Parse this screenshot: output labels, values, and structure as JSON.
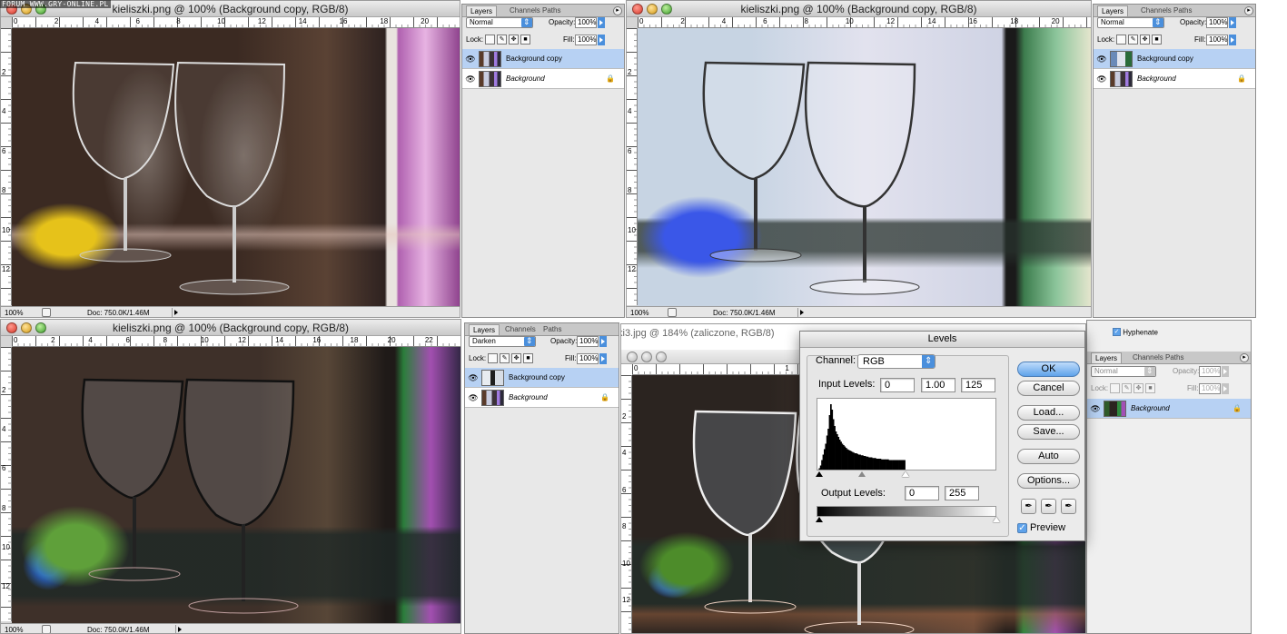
{
  "watermark": "FORUM WWW.GRY-ONLINE.PL",
  "windows": [
    {
      "title": "kieliszki.png @ 100% (Background copy, RGB/8)",
      "ruler_numbers": [
        "0",
        "2",
        "4",
        "6",
        "8",
        "10",
        "12",
        "14",
        "16",
        "18",
        "20"
      ],
      "ruler_v_numbers": [
        "2",
        "4",
        "6",
        "8",
        "10",
        "12"
      ],
      "zoom": "100%",
      "doc": "Doc: 750.0K/1.46M"
    },
    {
      "title": "kieliszki.png @ 100% (Background copy, RGB/8)",
      "ruler_numbers": [
        "0",
        "2",
        "4",
        "6",
        "8",
        "10",
        "12",
        "14",
        "16",
        "18",
        "20"
      ],
      "ruler_v_numbers": [
        "2",
        "4",
        "6",
        "8",
        "10",
        "12"
      ],
      "zoom": "100%",
      "doc": "Doc: 750.0K/1.46M"
    },
    {
      "title": "kieliszki.png @ 100% (Background copy, RGB/8)",
      "ruler_numbers": [
        "0",
        "2",
        "4",
        "6",
        "8",
        "10",
        "12",
        "14",
        "16",
        "18",
        "20",
        "22"
      ],
      "ruler_v_numbers": [
        "2",
        "4",
        "6",
        "8",
        "10",
        "12"
      ],
      "zoom": "100%",
      "doc": "Doc: 750.0K/1.46M"
    },
    {
      "title": "ki3.jpg @ 184% (zaliczone, RGB/8)",
      "ruler_numbers": [
        "0",
        "1",
        "2"
      ],
      "ruler_v_numbers": [
        "2",
        "4",
        "6",
        "8",
        "10",
        "12"
      ]
    }
  ],
  "palettes": [
    {
      "tabs": [
        "Layers",
        "Channels",
        "Paths"
      ],
      "blend_mode": "Normal",
      "opacity_label": "Opacity:",
      "opacity": "100%",
      "lock_label": "Lock:",
      "fill_label": "Fill:",
      "fill": "100%",
      "layers": [
        {
          "name": "Background copy",
          "selected": true,
          "locked": false
        },
        {
          "name": "Background",
          "selected": false,
          "locked": true
        }
      ]
    },
    {
      "tabs": [
        "Layers",
        "Channels",
        "Paths"
      ],
      "blend_mode": "Normal",
      "opacity_label": "Opacity:",
      "opacity": "100%",
      "lock_label": "Lock:",
      "fill_label": "Fill:",
      "fill": "100%",
      "layers": [
        {
          "name": "Background copy",
          "selected": true,
          "locked": false
        },
        {
          "name": "Background",
          "selected": false,
          "locked": true
        }
      ]
    },
    {
      "tabs": [
        "Layers",
        "Channels",
        "Paths"
      ],
      "blend_mode": "Darken",
      "opacity_label": "Opacity:",
      "opacity": "100%",
      "lock_label": "Lock:",
      "fill_label": "Fill:",
      "fill": "100%",
      "layers": [
        {
          "name": "Background copy",
          "selected": true,
          "locked": false
        },
        {
          "name": "Background",
          "selected": false,
          "locked": true
        }
      ]
    },
    {
      "tabs": [
        "Layers",
        "Channels",
        "Paths"
      ],
      "blend_mode": "Normal",
      "opacity_label": "Opacity:",
      "opacity": "100%",
      "lock_label": "Lock:",
      "fill_label": "Fill:",
      "fill": "100%",
      "hyphenate_label": "Hyphenate",
      "layers": [
        {
          "name": "Background",
          "selected": true,
          "locked": true
        }
      ]
    }
  ],
  "levels": {
    "title": "Levels",
    "channel_label": "Channel:",
    "channel": "RGB",
    "input_label": "Input Levels:",
    "input_black": "0",
    "input_gamma": "1.00",
    "input_white": "125",
    "output_label": "Output Levels:",
    "output_black": "0",
    "output_white": "255",
    "buttons": {
      "ok": "OK",
      "cancel": "Cancel",
      "load": "Load...",
      "save": "Save...",
      "auto": "Auto",
      "options": "Options..."
    },
    "preview_label": "Preview",
    "preview_checked": true,
    "histogram": [
      0,
      2,
      6,
      14,
      22,
      30,
      38,
      50,
      60,
      80,
      96,
      88,
      74,
      64,
      56,
      52,
      48,
      44,
      41,
      38,
      36,
      34,
      32,
      30,
      29,
      28,
      27,
      26,
      25,
      24,
      24,
      23,
      22,
      22,
      21,
      21,
      20,
      20,
      19,
      19,
      18,
      18,
      18,
      17,
      17,
      17,
      16,
      16,
      16,
      16,
      15,
      15,
      15,
      15,
      15,
      15,
      14,
      14,
      14,
      14,
      14,
      14,
      14,
      14,
      14,
      14,
      14,
      14,
      14,
      0
    ]
  }
}
